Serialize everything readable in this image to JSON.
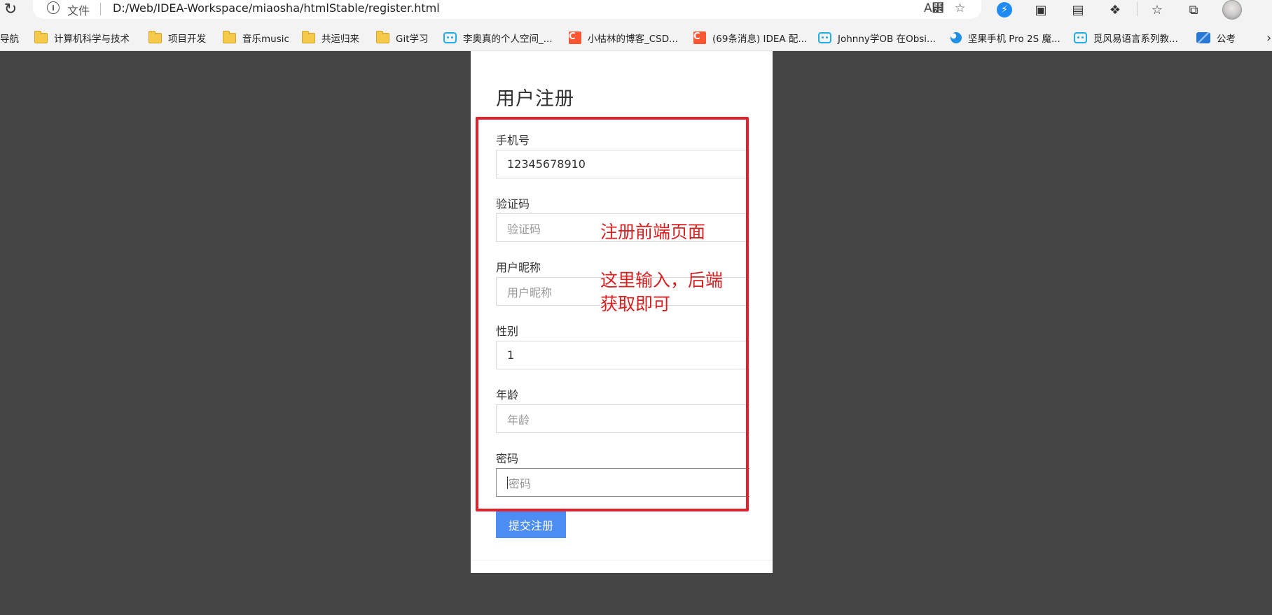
{
  "browser": {
    "file_label": "文件",
    "url": "D:/Web/IDEA-Workspace/miaosha/htmlStable/register.html"
  },
  "bookmarks": [
    {
      "label": "导航",
      "icon": "folder-icon"
    },
    {
      "label": "计算机科学与技术",
      "icon": "folder-icon"
    },
    {
      "label": "项目开发",
      "icon": "folder-icon"
    },
    {
      "label": "音乐music",
      "icon": "folder-icon"
    },
    {
      "label": "共运归来",
      "icon": "folder-icon"
    },
    {
      "label": "Git学习",
      "icon": "folder-icon"
    },
    {
      "label": "李奥真的个人空间_...",
      "icon": "bilibili-icon"
    },
    {
      "label": "小枯林的博客_CSD...",
      "icon": "csdn-icon"
    },
    {
      "label": "(69条消息) IDEA 配...",
      "icon": "csdn-icon"
    },
    {
      "label": "Johnny学OB 在Obsi...",
      "icon": "bilibili-icon"
    },
    {
      "label": "坚果手机 Pro 2S 魔...",
      "icon": "jianguo-icon"
    },
    {
      "label": "觅风易语言系列教...",
      "icon": "bilibili-icon"
    },
    {
      "label": "公考",
      "icon": "gongkao-icon"
    }
  ],
  "form": {
    "title": "用户注册",
    "fields": [
      {
        "label": "手机号",
        "value": "12345678910",
        "placeholder": ""
      },
      {
        "label": "验证码",
        "value": "",
        "placeholder": "验证码"
      },
      {
        "label": "用户昵称",
        "value": "",
        "placeholder": "用户昵称"
      },
      {
        "label": "性别",
        "value": "1",
        "placeholder": ""
      },
      {
        "label": "年龄",
        "value": "",
        "placeholder": "年龄"
      },
      {
        "label": "密码",
        "value": "",
        "placeholder": "密码"
      }
    ],
    "submit_label": "提交注册"
  },
  "annotations": {
    "note1": "注册前端页面",
    "note2_line1": "这里输入，后端",
    "note2_line2": "获取即可",
    "box_color": "#e3202b"
  },
  "colors": {
    "page_background": "#454545",
    "submit_button": "#4b8df2"
  }
}
